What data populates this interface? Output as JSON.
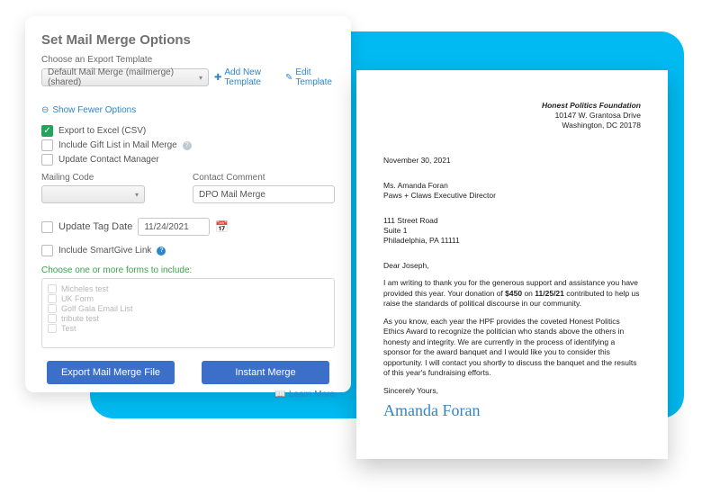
{
  "panel": {
    "title": "Set Mail Merge Options",
    "template_label": "Choose an Export Template",
    "template_selected": "Default Mail Merge (mailmerge) (shared)",
    "add_template": "Add New Template",
    "edit_template": "Edit Template",
    "show_fewer": "Show Fewer Options",
    "chk_excel": "Export to Excel (CSV)",
    "chk_giftlist": "Include Gift List in Mail Merge",
    "chk_contactmgr": "Update Contact Manager",
    "mailing_code_label": "Mailing Code",
    "contact_comment_label": "Contact Comment",
    "contact_comment_value": "DPO Mail Merge",
    "update_tag_date_label": "Update Tag Date",
    "update_tag_date_value": "11/24/2021",
    "include_smartgive": "Include SmartGive Link",
    "forms_label": "Choose one or more forms to include:",
    "forms": [
      "Micheles test",
      "UK Form",
      "Golf Gala Email List",
      "tribute test",
      "Test"
    ],
    "btn_export": "Export Mail Merge File",
    "btn_instant": "Instant Merge",
    "learn_more": "Learn More"
  },
  "letter": {
    "org_name": "Honest Politics Foundation",
    "org_addr1": "10147 W. Grantosa Drive",
    "org_addr2": "Washington, DC 20178",
    "date": "November 30, 2021",
    "recipient_name": "Ms. Amanda Foran",
    "recipient_title": "Paws + Claws Executive Director",
    "addr1": "111 Street Road",
    "addr2": "Suite 1",
    "addr3": "Philadelphia, PA  11111",
    "greeting": "Dear Joseph,",
    "p1a": "I am writing to thank you for the generous support and assistance you have provided this year.  Your donation of ",
    "p1_amount": "$450",
    "p1b": " on ",
    "p1_date": "11/25/21",
    "p1c": " contributed to help us raise the standards of political discourse in our community.",
    "p2": "As you know, each year the HPF provides the coveted Honest Politics Ethics Award to recognize the politician who stands above the others in honesty and integrity.  We are currently in the process of identifying a sponsor for the award banquet and I would like you to consider this opportunity.  I will contact you shortly to discuss the banquet and the results of this year's fundraising efforts.",
    "closing": "Sincerely Yours,",
    "signature": "Amanda Foran"
  }
}
